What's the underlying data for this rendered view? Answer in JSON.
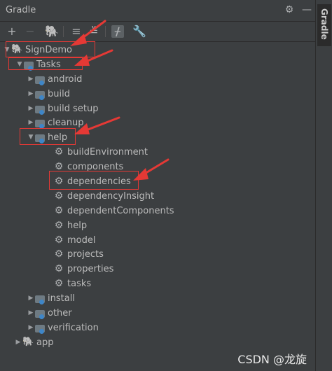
{
  "window": {
    "title": "Gradle"
  },
  "side_tab": {
    "label": "Gradle"
  },
  "toolbar": {
    "items": [
      "add-icon",
      "remove-icon",
      "elephant-icon",
      "expand-all-icon",
      "collapse-all-icon",
      "toggle-offline-icon",
      "wrench-icon"
    ]
  },
  "tree": {
    "root": "SignDemo",
    "tasks": "Tasks",
    "groups": {
      "android": "android",
      "build": "build",
      "build_setup": "build setup",
      "cleanup": "cleanup",
      "help": "help",
      "install": "install",
      "other": "other",
      "verification": "verification"
    },
    "help_tasks": {
      "t0": "buildEnvironment",
      "t1": "components",
      "t2": "dependencies",
      "t3": "dependencyInsight",
      "t4": "dependentComponents",
      "t5": "help",
      "t6": "model",
      "t7": "projects",
      "t8": "properties",
      "t9": "tasks"
    },
    "app": "app"
  },
  "watermark": "CSDN @龙旋",
  "colors": {
    "highlight": "#e53935",
    "background": "#3c3f41",
    "text": "#bbbbbb"
  }
}
